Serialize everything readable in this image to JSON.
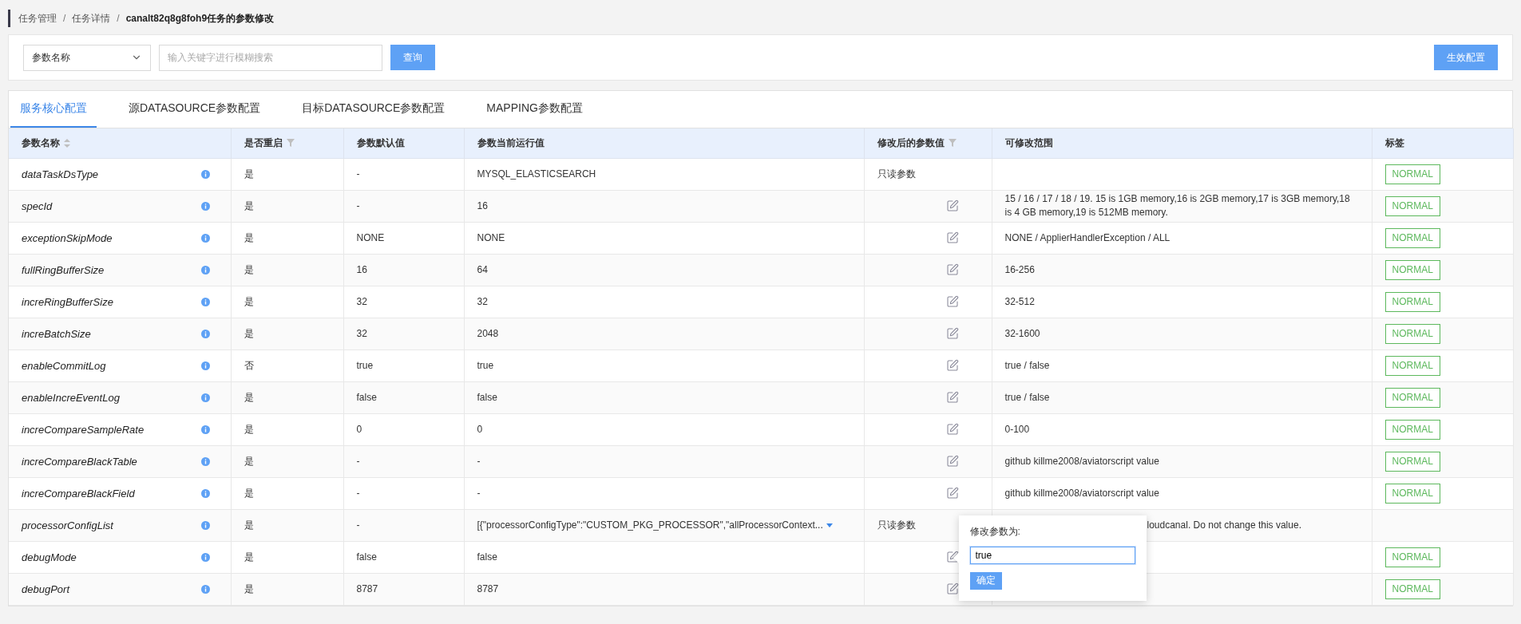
{
  "breadcrumb": {
    "separator": "/",
    "items": [
      "任务管理",
      "任务详情",
      "canalt82q8g8foh9任务的参数修改"
    ]
  },
  "toolbar": {
    "select": "参数名称",
    "search": {
      "placeholder": "输入关键字进行模糊搜索"
    },
    "query_button": "查询",
    "apply_button": "生效配置"
  },
  "tabs": [
    {
      "label": "服务核心配置",
      "selected": true
    },
    {
      "label": "源DATASOURCE参数配置",
      "selected": false
    },
    {
      "label": "目标DATASOURCE参数配置",
      "selected": false
    },
    {
      "label": "MAPPING参数配置",
      "selected": false
    }
  ],
  "table": {
    "columns": [
      {
        "label": "参数名称",
        "sortable": true
      },
      {
        "label": "是否重启",
        "filterable": true
      },
      {
        "label": "参数默认值"
      },
      {
        "label": "参数当前运行值"
      },
      {
        "label": "修改后的参数值",
        "filterable": true
      },
      {
        "label": "可修改范围"
      },
      {
        "label": "标签"
      }
    ],
    "rows": [
      {
        "name": "dataTaskDsType",
        "restart": "是",
        "default": "-",
        "current": "MYSQL_ELASTICSEARCH",
        "modified": {
          "kind": "text",
          "text": "只读参数"
        },
        "tag": "NORMAL"
      },
      {
        "name": "specId",
        "restart": "是",
        "default": "-",
        "current": "16",
        "modified": {
          "kind": "edit"
        },
        "range": "15 / 16 / 17 / 18 / 19. 15 is 1GB memory,16 is 2GB memory,17 is 3GB memory,18 is 4 GB memory,19 is 512MB memory.",
        "tag": "NORMAL"
      },
      {
        "name": "exceptionSkipMode",
        "restart": "是",
        "default": "NONE",
        "current": "NONE",
        "modified": {
          "kind": "edit"
        },
        "range": "NONE / ApplierHandlerException / ALL",
        "tag": "NORMAL"
      },
      {
        "name": "fullRingBufferSize",
        "restart": "是",
        "default": "16",
        "current": "64",
        "modified": {
          "kind": "edit"
        },
        "range": "16-256",
        "tag": "NORMAL"
      },
      {
        "name": "increRingBufferSize",
        "restart": "是",
        "default": "32",
        "current": "32",
        "modified": {
          "kind": "edit"
        },
        "range": "32-512",
        "tag": "NORMAL"
      },
      {
        "name": "increBatchSize",
        "restart": "是",
        "default": "32",
        "current": "2048",
        "modified": {
          "kind": "edit"
        },
        "range": "32-1600",
        "tag": "NORMAL"
      },
      {
        "name": "enableCommitLog",
        "restart": "否",
        "default": "true",
        "current": "true",
        "modified": {
          "kind": "edit"
        },
        "range": "true / false",
        "tag": "NORMAL"
      },
      {
        "name": "enableIncreEventLog",
        "restart": "是",
        "default": "false",
        "current": "false",
        "modified": {
          "kind": "edit"
        },
        "range": "true / false",
        "tag": "NORMAL"
      },
      {
        "name": "increCompareSampleRate",
        "restart": "是",
        "default": "0",
        "current": "0",
        "modified": {
          "kind": "edit"
        },
        "range": "0-100",
        "tag": "NORMAL"
      },
      {
        "name": "increCompareBlackTable",
        "restart": "是",
        "default": "-",
        "current": "-",
        "modified": {
          "kind": "edit"
        },
        "range": "github killme2008/aviatorscript value",
        "tag": "NORMAL"
      },
      {
        "name": "increCompareBlackField",
        "restart": "是",
        "default": "-",
        "current": "-",
        "modified": {
          "kind": "edit"
        },
        "range": "github killme2008/aviatorscript value",
        "tag": "NORMAL"
      },
      {
        "name": "processorConfigList",
        "restart": "是",
        "default": "-",
        "current": "[{\"processorConfigType\":\"CUSTOM_PKG_PROCESSOR\",\"allProcessorContext...",
        "expandable": true,
        "modified": {
          "kind": "text",
          "text": "只读参数"
        },
        "range": "loudcanal. Do not change this value."
      },
      {
        "name": "debugMode",
        "restart": "是",
        "default": "false",
        "current": "false",
        "modified": {
          "kind": "edit"
        },
        "editing": true,
        "tag": "NORMAL"
      },
      {
        "name": "debugPort",
        "restart": "是",
        "default": "8787",
        "current": "8787",
        "modified": {
          "kind": "edit"
        },
        "tag": "NORMAL"
      }
    ]
  },
  "popover": {
    "label": "修改参数为:",
    "value": "true",
    "button": "确定"
  }
}
